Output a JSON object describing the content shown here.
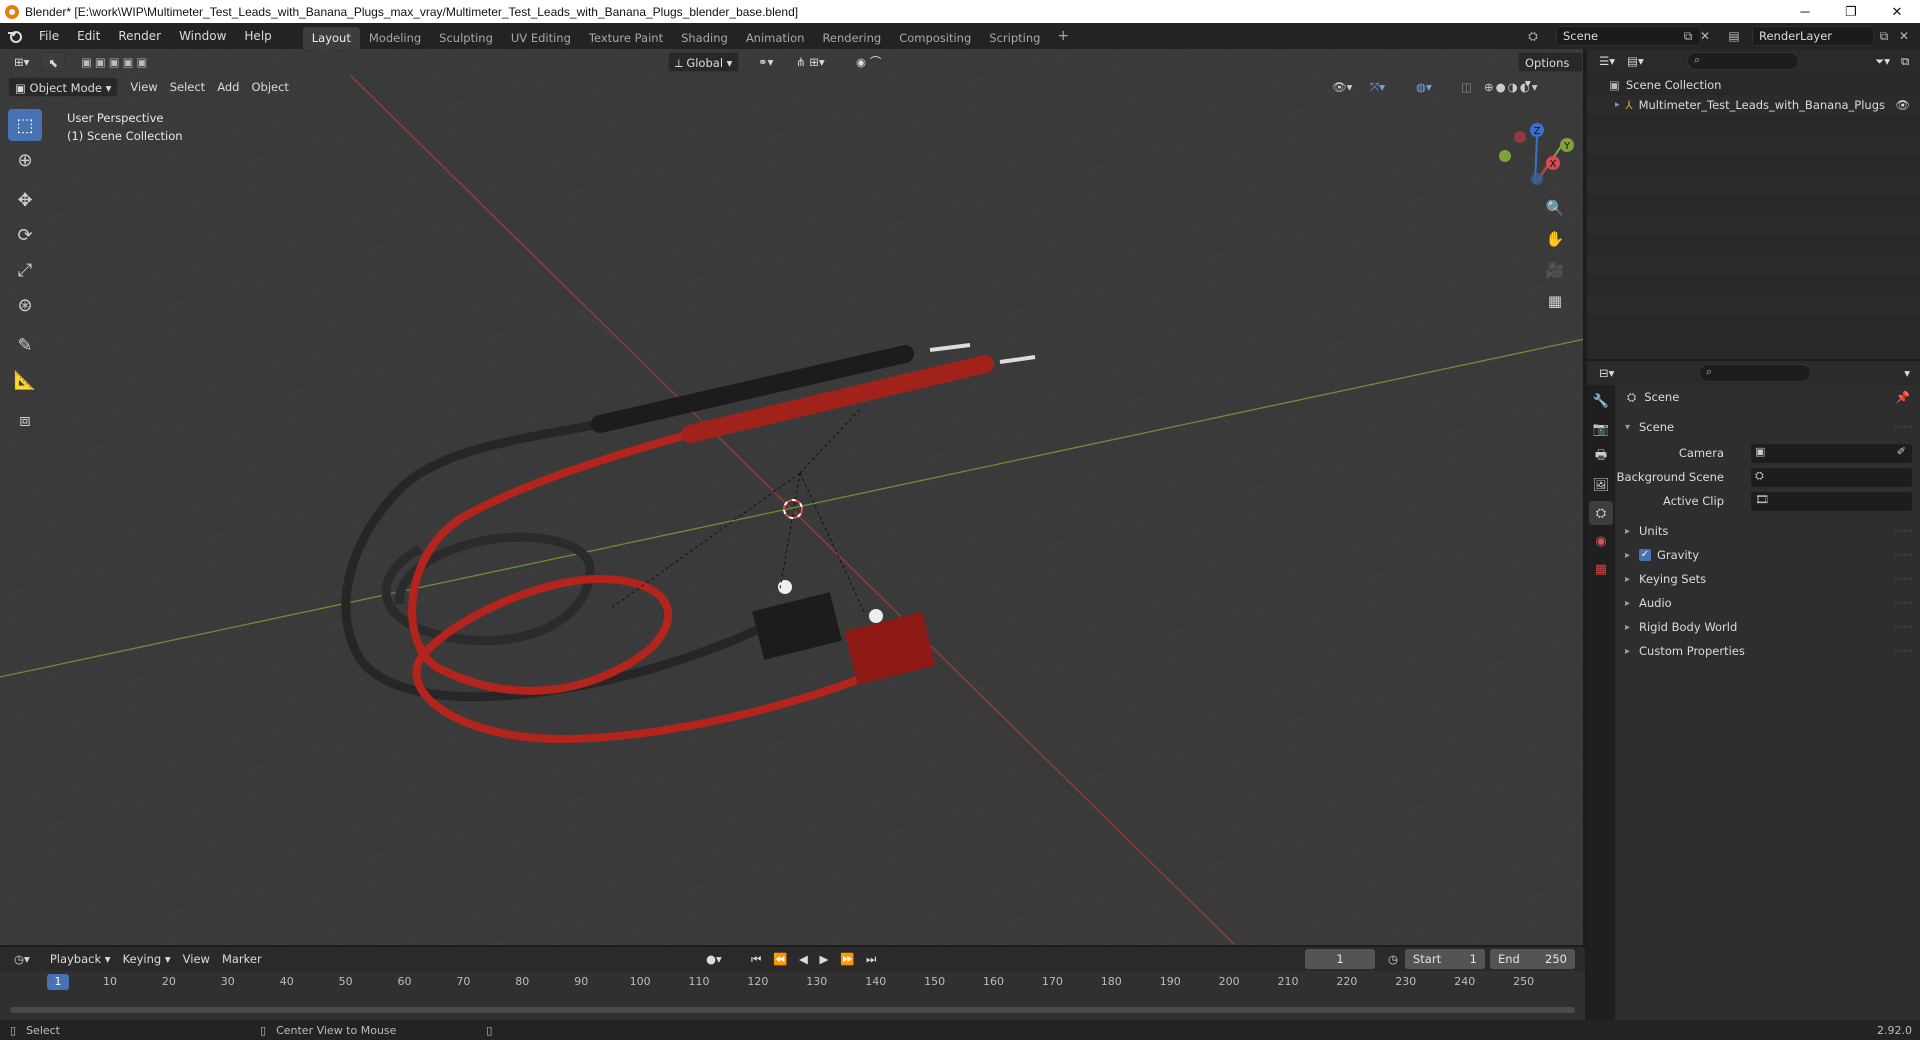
{
  "window": {
    "title": "Blender* [E:\\work\\WIP\\Multimeter_Test_Leads_with_Banana_Plugs_max_vray/Multimeter_Test_Leads_with_Banana_Plugs_blender_base.blend]",
    "minimize": "─",
    "maximize": "❐",
    "close": "✕"
  },
  "menu": {
    "items": [
      "File",
      "Edit",
      "Render",
      "Window",
      "Help"
    ]
  },
  "workspaces": [
    "Layout",
    "Modeling",
    "Sculpting",
    "UV Editing",
    "Texture Paint",
    "Shading",
    "Animation",
    "Rendering",
    "Compositing",
    "Scripting"
  ],
  "workspace_add": "+",
  "scene": {
    "name": "Scene",
    "view_layer": "RenderLayer"
  },
  "viewport": {
    "mode": "Object Mode",
    "menus": [
      "View",
      "Select",
      "Add",
      "Object"
    ],
    "transform_orientation": "Global",
    "options": "Options",
    "info_line1": "User Perspective",
    "info_line2": "(1) Scene Collection",
    "gizmo": {
      "x": "X",
      "y": "Y",
      "z": "Z"
    }
  },
  "tools": [
    "select-box",
    "cursor",
    "move",
    "rotate",
    "scale",
    "transform",
    "annotate",
    "measure",
    "add-cube"
  ],
  "timeline": {
    "menus": [
      "Playback",
      "Keying",
      "View",
      "Marker"
    ],
    "current_frame": "1",
    "start_label": "Start",
    "start": "1",
    "end_label": "End",
    "end": "250",
    "ruler": [
      "1",
      "10",
      "20",
      "30",
      "40",
      "50",
      "60",
      "70",
      "80",
      "90",
      "100",
      "110",
      "120",
      "130",
      "140",
      "150",
      "160",
      "170",
      "180",
      "190",
      "200",
      "210",
      "220",
      "230",
      "240",
      "250"
    ]
  },
  "status": {
    "select": "Select",
    "center_view": "Center View to Mouse",
    "version": "2.92.0"
  },
  "outliner": {
    "collection": "Scene Collection",
    "object": "Multimeter_Test_Leads_with_Banana_Plugs"
  },
  "properties": {
    "context": "Scene",
    "panel_title": "Scene",
    "camera_label": "Camera",
    "background_scene_label": "Background Scene",
    "active_clip_label": "Active Clip",
    "panels": [
      "Units",
      "Gravity",
      "Keying Sets",
      "Audio",
      "Rigid Body World",
      "Custom Properties"
    ],
    "gravity_enabled": true
  },
  "colors": {
    "accent": "#4772b3",
    "x_axis": "#b8383f",
    "y_axis": "#7fa33a",
    "red_lead": "#c3241c",
    "black_lead": "#1c1c1c"
  }
}
